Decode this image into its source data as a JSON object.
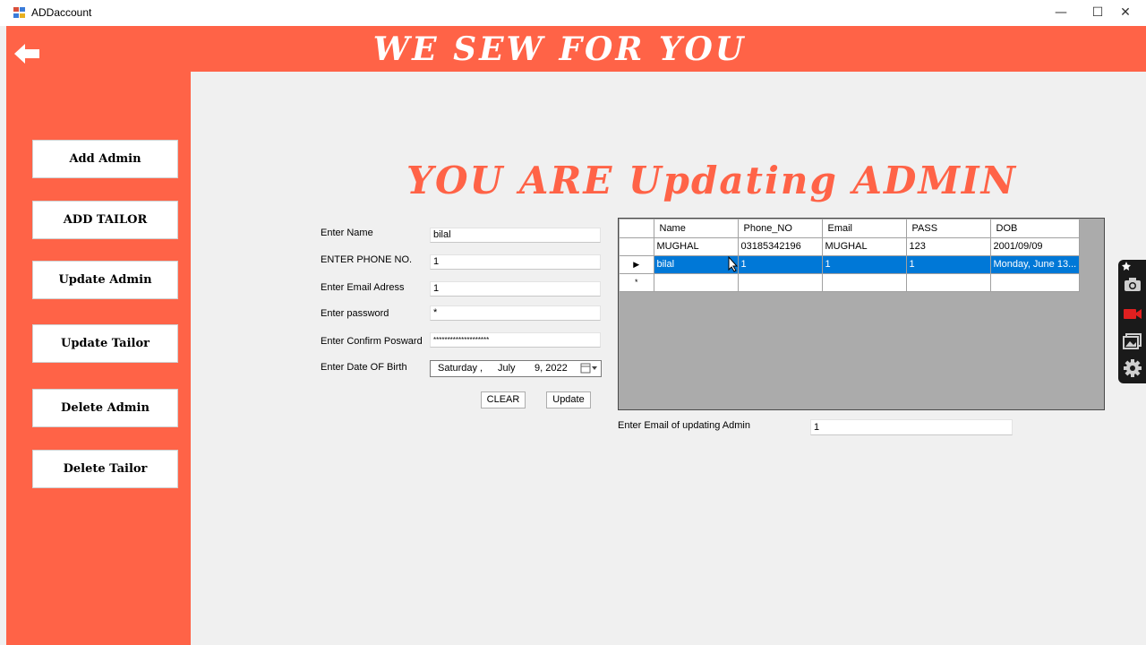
{
  "window": {
    "title": "ADDaccount",
    "minimize": "—",
    "maximize": "☐",
    "close": "✕"
  },
  "header": {
    "brand": "WE SEW FOR YOU"
  },
  "sidebar": {
    "items": [
      {
        "label": "Add Admin"
      },
      {
        "label": "ADD TAILOR"
      },
      {
        "label": "Update Admin"
      },
      {
        "label": "Update Tailor"
      },
      {
        "label": "Delete Admin"
      },
      {
        "label": "Delete Tailor"
      }
    ]
  },
  "main": {
    "title": "YOU ARE Updating ADMIN"
  },
  "form": {
    "name_label": "Enter Name",
    "name_value": "bilal",
    "phone_label": "ENTER PHONE NO.",
    "phone_value": "1",
    "email_label": "Enter Email Adress",
    "email_value": "1",
    "password_label": "Enter password",
    "password_value": "*",
    "confirm_label": "Enter Confirm Posward",
    "confirm_value": "********************",
    "dob_label": "Enter Date OF Birth",
    "dob_day": "Saturday",
    "dob_comma": ",",
    "dob_month": "July",
    "dob_date": "9, 2022",
    "clear_label": "CLEAR",
    "update_label": "Update"
  },
  "grid": {
    "columns": [
      "Name",
      "Phone_NO",
      "Email",
      "PASS",
      "DOB"
    ],
    "rows": [
      {
        "marker": "",
        "cells": [
          "MUGHAL",
          "03185342196",
          "MUGHAL",
          "123",
          "2001/09/09"
        ]
      },
      {
        "marker": "▶",
        "cells": [
          "bilal",
          "1",
          "1",
          "1",
          "Monday, June 13..."
        ]
      },
      {
        "marker": "*",
        "cells": [
          "",
          "",
          "",
          "",
          ""
        ]
      }
    ]
  },
  "update_email": {
    "label": "Enter Email of updating Admin",
    "value": "1"
  },
  "colors": {
    "accent": "#ff6347",
    "selection": "#0078d7"
  }
}
